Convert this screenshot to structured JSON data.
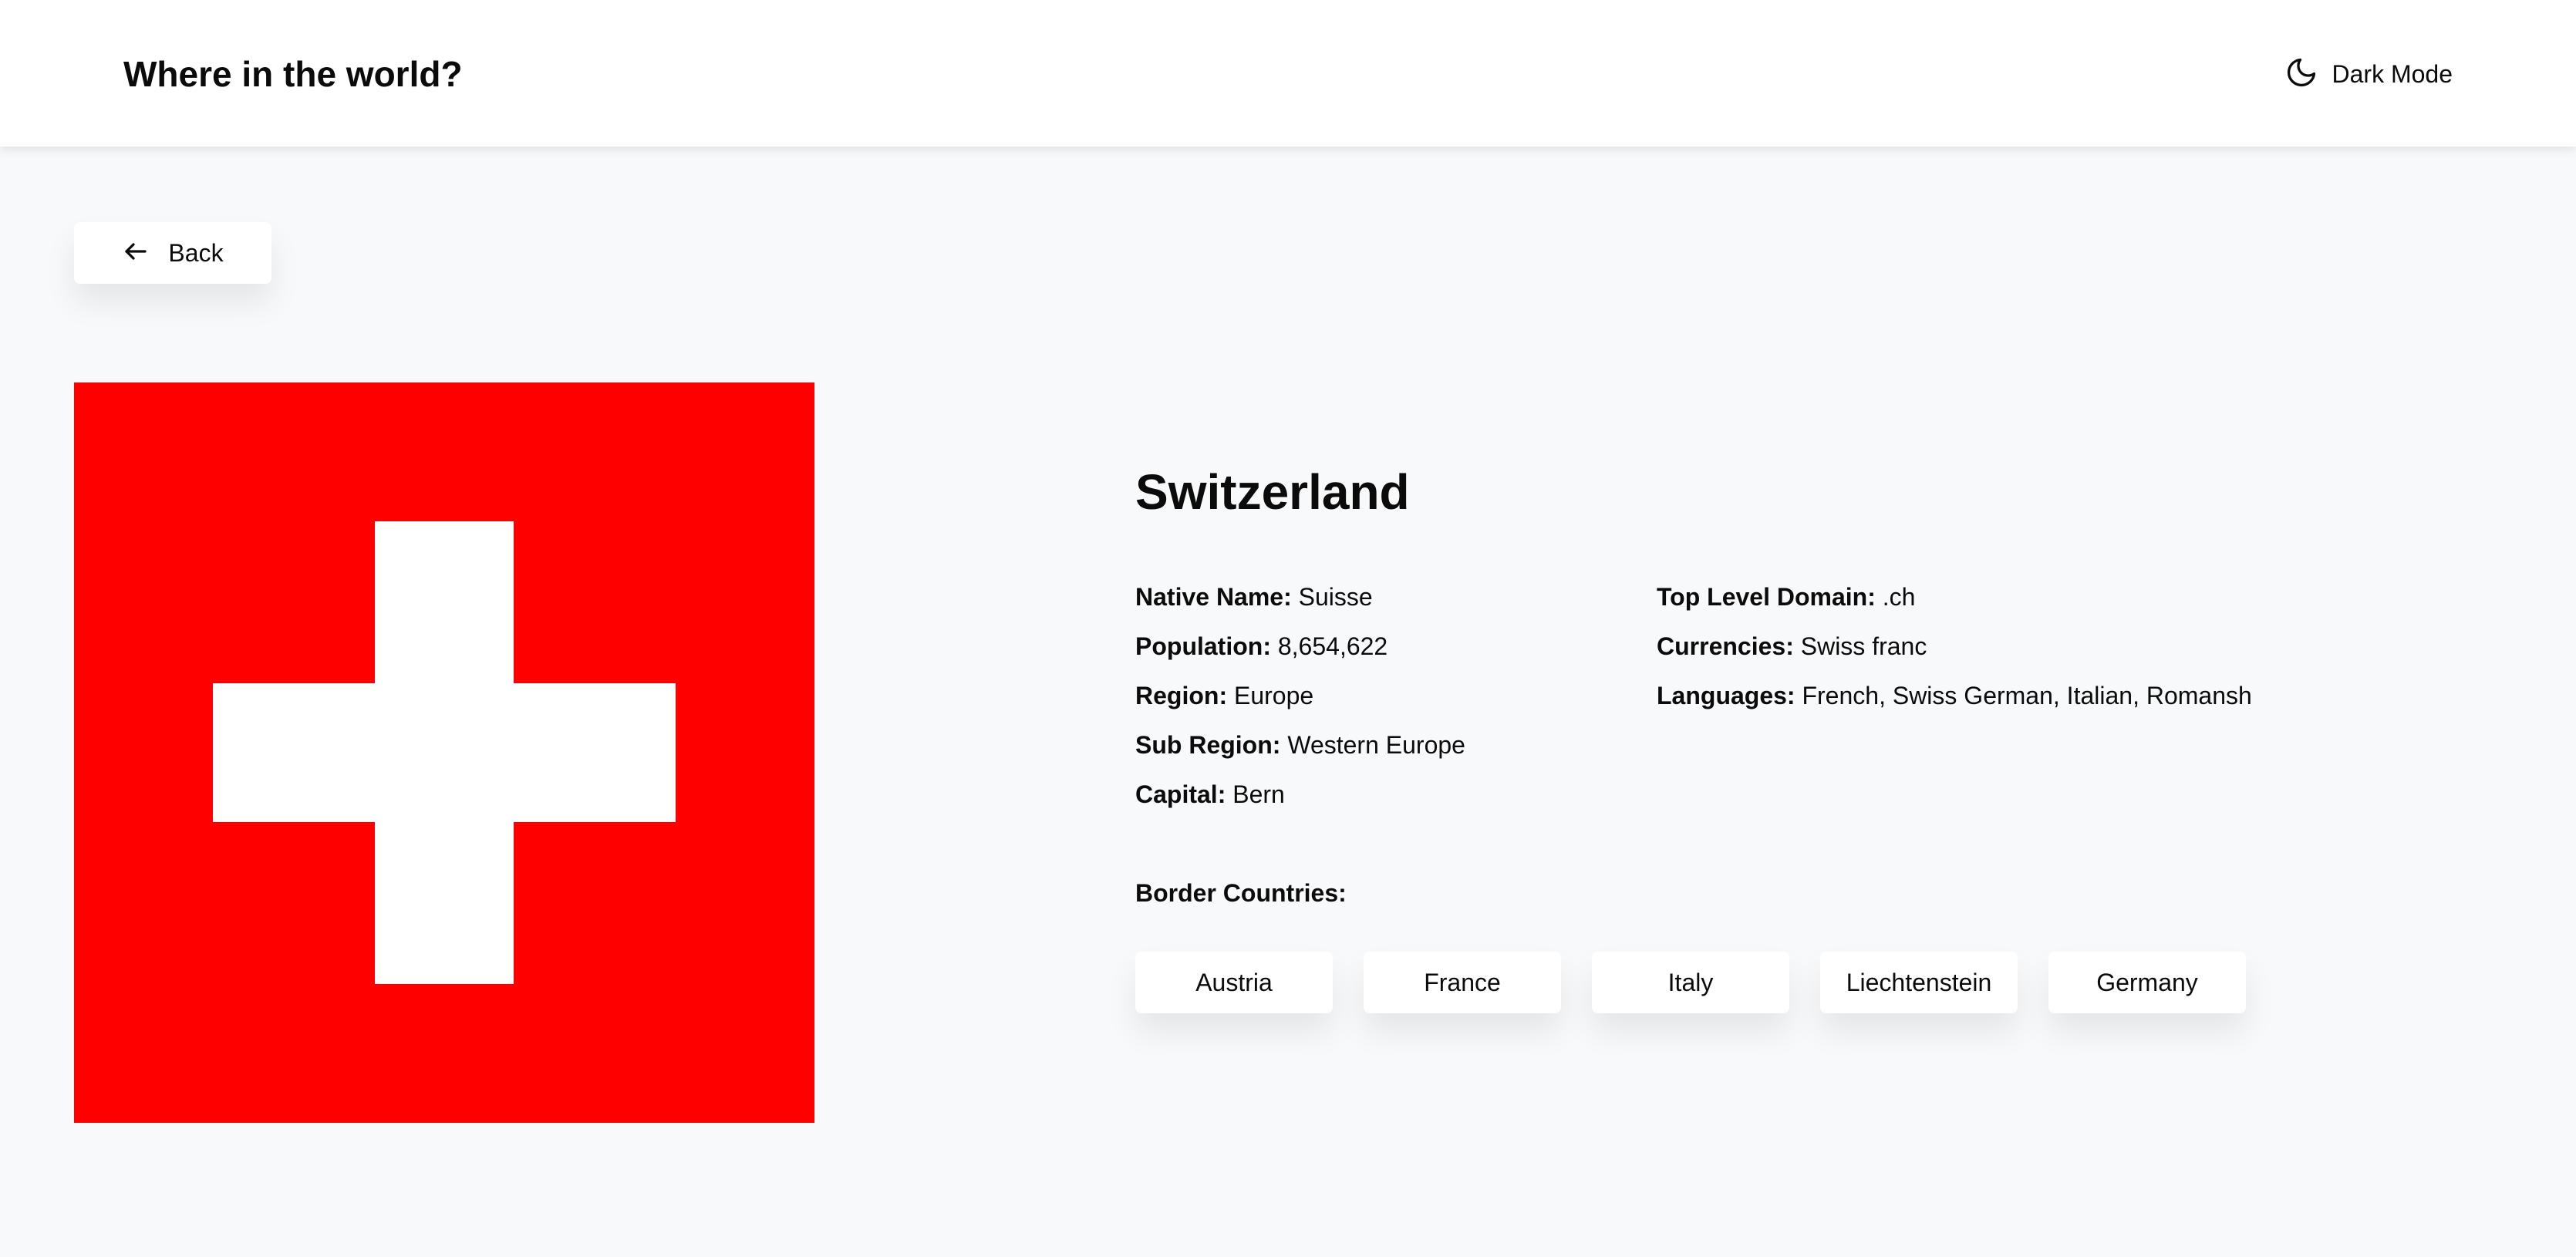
{
  "header": {
    "title": "Where in the world?",
    "theme_toggle": {
      "label": "Dark Mode",
      "icon": "moon-icon"
    }
  },
  "back_button": {
    "label": "Back",
    "icon": "arrow-left-icon"
  },
  "flag": {
    "icon": "flag-switzerland",
    "colors": {
      "field": "#ff0000",
      "cross": "#ffffff"
    }
  },
  "country": {
    "name": "Switzerland",
    "details_left": [
      {
        "label": "Native Name:",
        "value": "Suisse"
      },
      {
        "label": "Population:",
        "value": "8,654,622"
      },
      {
        "label": "Region:",
        "value": "Europe"
      },
      {
        "label": "Sub Region:",
        "value": "Western Europe"
      },
      {
        "label": "Capital:",
        "value": "Bern"
      }
    ],
    "details_right": [
      {
        "label": "Top Level Domain:",
        "value": ".ch"
      },
      {
        "label": "Currencies:",
        "value": "Swiss franc"
      },
      {
        "label": "Languages:",
        "value": "French, Swiss German, Italian, Romansh"
      }
    ]
  },
  "border_countries": {
    "label": "Border Countries:",
    "items": [
      "Austria",
      "France",
      "Italy",
      "Liechtenstein",
      "Germany"
    ]
  },
  "colors": {
    "page_background": "#f8f9fb",
    "surface": "#ffffff",
    "text": "#0b0b0b"
  }
}
